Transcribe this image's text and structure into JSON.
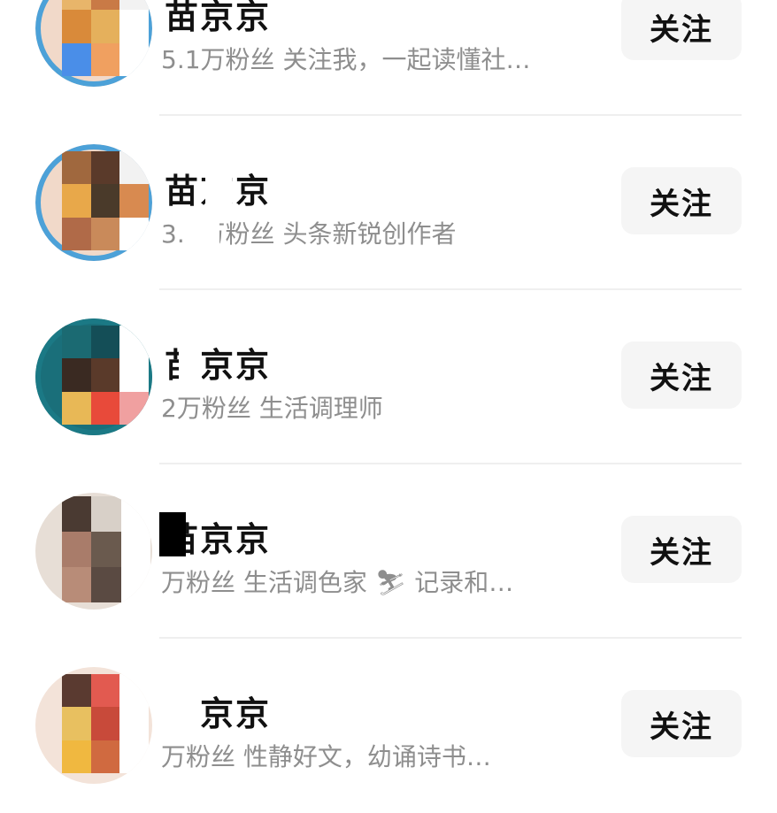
{
  "accounts": [
    {
      "name": "苗京京",
      "followers": "5.1万粉丝",
      "bio": "关注我，一起读懂社…",
      "follow_label": "关注",
      "emoji": ""
    },
    {
      "name": "苗京京",
      "followers": "3.6万粉丝",
      "bio": "头条新锐创作者",
      "follow_label": "关注",
      "emoji": ""
    },
    {
      "name": "苗京京",
      "followers": "2万粉丝",
      "bio": "生活调理师",
      "follow_label": "关注",
      "emoji": ""
    },
    {
      "name": "苗京京",
      "followers": "万粉丝",
      "bio": "生活调色家",
      "follow_label": "关注",
      "emoji": "⛷",
      "bio_after": "记录和…"
    },
    {
      "name": "苗京京",
      "followers": "万粉丝",
      "bio": "性静好文，幼诵诗书…",
      "follow_label": "关注",
      "emoji": ""
    }
  ],
  "colors": {
    "name": "#111111",
    "desc": "#8e8e8e",
    "button_bg": "#f5f5f5",
    "divider": "#efefef"
  }
}
